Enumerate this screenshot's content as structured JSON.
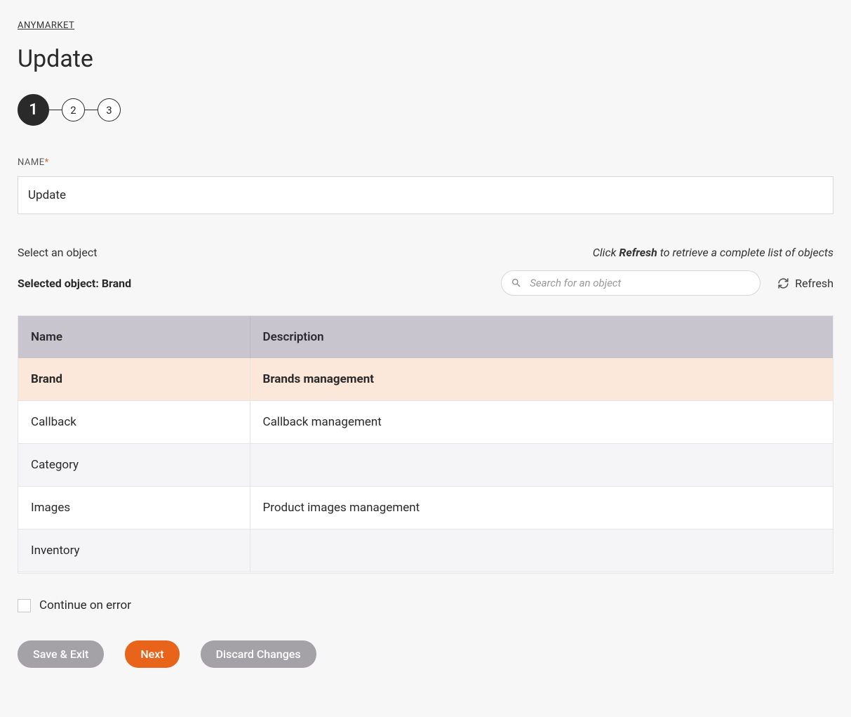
{
  "breadcrumb": "ANYMARKET",
  "page_title": "Update",
  "stepper": {
    "steps": [
      "1",
      "2",
      "3"
    ],
    "active_index": 0
  },
  "name_field": {
    "label": "NAME",
    "required_mark": "*",
    "value": "Update"
  },
  "object_section": {
    "select_label": "Select an object",
    "hint_prefix": "Click ",
    "hint_bold": "Refresh",
    "hint_suffix": " to retrieve a complete list of objects",
    "selected_label": "Selected object: Brand",
    "search_placeholder": "Search for an object",
    "refresh_label": "Refresh"
  },
  "table": {
    "headers": {
      "name": "Name",
      "description": "Description"
    },
    "rows": [
      {
        "name": "Brand",
        "description": "Brands management",
        "selected": true
      },
      {
        "name": "Callback",
        "description": "Callback management",
        "selected": false
      },
      {
        "name": "Category",
        "description": "",
        "selected": false
      },
      {
        "name": "Images",
        "description": "Product images management",
        "selected": false
      },
      {
        "name": "Inventory",
        "description": "",
        "selected": false
      }
    ]
  },
  "continue_checkbox": {
    "label": "Continue on error",
    "checked": false
  },
  "buttons": {
    "save_exit": "Save & Exit",
    "next": "Next",
    "discard": "Discard Changes"
  }
}
